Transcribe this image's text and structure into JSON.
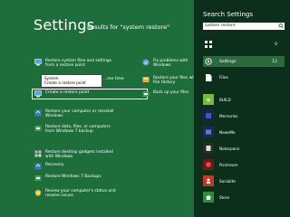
{
  "main": {
    "title": "Settings",
    "results_text": "Results for \"system restore\""
  },
  "left_items": [
    {
      "label": "Restore system files and settings from a restore point",
      "icon": "system-icon"
    },
    {
      "label": "Create a restore point",
      "icon": "system-icon"
    },
    {
      "label": "Restore your computer or reinstall Windows",
      "icon": "recovery-icon"
    },
    {
      "label": "Restore data, files, or computers from Windows 7 backup",
      "icon": "backup-icon"
    },
    {
      "label": "Restore desktop gadgets installed with Windows",
      "icon": "gadgets-icon"
    },
    {
      "label": "Recovery",
      "icon": "recovery-icon"
    },
    {
      "label": "Restore Windows 7 Backups",
      "icon": "backup-icon"
    },
    {
      "label": "Review your computer's status and resolve issues",
      "icon": "action-center-icon"
    }
  ],
  "mid_items": [
    {
      "label": "…me time",
      "icon": "clock-icon"
    }
  ],
  "right_items": [
    {
      "label": "Fix problems with Windows",
      "icon": "troubleshoot-icon"
    },
    {
      "label": "Restore your files with File History",
      "icon": "file-history-icon"
    },
    {
      "label": "Back up your files",
      "icon": "backup-icon"
    }
  ],
  "tooltip": {
    "title": "System",
    "desc": "Create a restore point"
  },
  "panel": {
    "title": "Search Settings",
    "search_value": "system restore",
    "categories": [
      {
        "label": "",
        "count": "0",
        "icon": "apps-grid-icon"
      },
      {
        "label": "Settings",
        "count": "12",
        "icon": "gear-icon"
      },
      {
        "label": "Files",
        "count": "",
        "icon": "files-icon"
      }
    ],
    "apps": [
      {
        "label": "BUILD",
        "tile_text": "/b",
        "color": "#78b944"
      },
      {
        "label": "Memories",
        "tile_text": "",
        "color": "#1e1e5a"
      },
      {
        "label": "NewsMe",
        "tile_text": "",
        "color": "#1a2a5a"
      },
      {
        "label": "Notespace",
        "tile_text": "",
        "color": "#2a2a2a"
      },
      {
        "label": "Picstream",
        "tile_text": "",
        "color": "#6a1a1a"
      },
      {
        "label": "Socialite",
        "tile_text": "",
        "color": "#c0392b"
      },
      {
        "label": "Store",
        "tile_text": "",
        "color": "#2f8c3b"
      }
    ]
  }
}
